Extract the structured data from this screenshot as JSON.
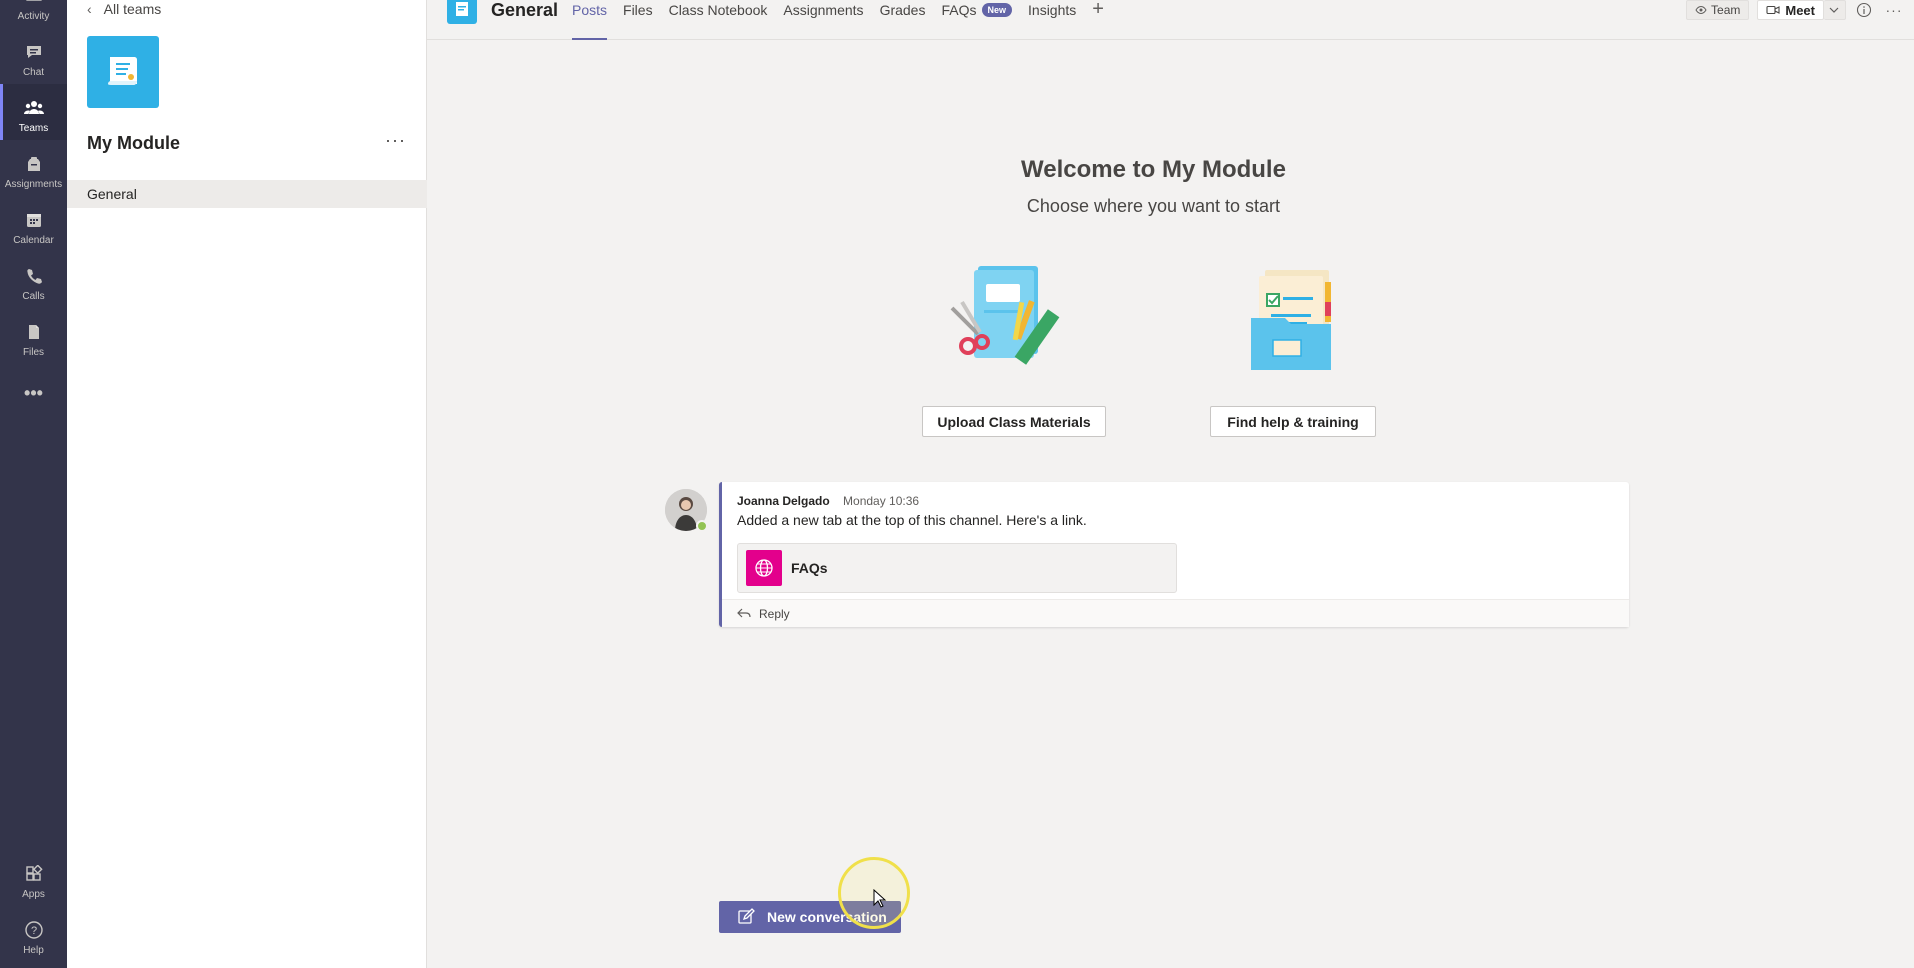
{
  "rail": {
    "items": [
      {
        "label": "Activity",
        "icon": "bell-icon"
      },
      {
        "label": "Chat",
        "icon": "chat-icon"
      },
      {
        "label": "Teams",
        "icon": "teams-icon",
        "active": true
      },
      {
        "label": "Assignments",
        "icon": "assignments-icon"
      },
      {
        "label": "Calendar",
        "icon": "calendar-icon"
      },
      {
        "label": "Calls",
        "icon": "phone-icon"
      },
      {
        "label": "Files",
        "icon": "file-icon"
      }
    ],
    "more": "...",
    "bottom": [
      {
        "label": "Apps",
        "icon": "apps-icon"
      },
      {
        "label": "Help",
        "icon": "help-icon"
      }
    ]
  },
  "panel": {
    "back_label": "All teams",
    "team_name": "My Module",
    "more": "···",
    "channels": [
      "General"
    ]
  },
  "header": {
    "channel_title": "General",
    "tabs": [
      {
        "label": "Posts",
        "active": true
      },
      {
        "label": "Files"
      },
      {
        "label": "Class Notebook"
      },
      {
        "label": "Assignments"
      },
      {
        "label": "Grades"
      },
      {
        "label": "FAQs",
        "badge": "New"
      },
      {
        "label": "Insights"
      }
    ],
    "add_tab": "+",
    "team_button": "Team",
    "meet_button": "Meet"
  },
  "welcome": {
    "title": "Welcome to My Module",
    "subtitle": "Choose where you want to start",
    "upload_button": "Upload Class Materials",
    "help_button": "Find help & training"
  },
  "post": {
    "author": "Joanna Delgado",
    "time": "Monday 10:36",
    "body": "Added a new tab at the top of this channel. Here's a link.",
    "card_label": "FAQs",
    "reply_label": "Reply"
  },
  "new_conversation": "New conversation",
  "colors": {
    "rail": "#33344a",
    "accent": "#6264a7",
    "faq_card": "#e3008c",
    "team_tile": "#2fb0e5"
  }
}
